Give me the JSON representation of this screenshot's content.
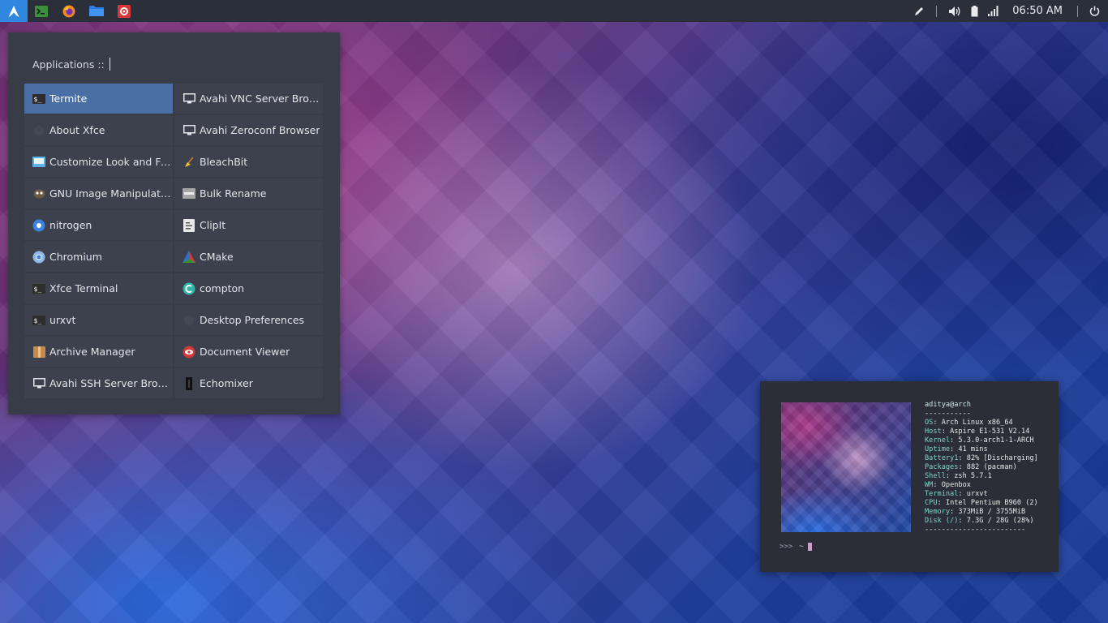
{
  "panel": {
    "launchers": [
      "terminal-icon",
      "firefox-icon",
      "files-icon",
      "settings-icon"
    ],
    "clock": "06:50 AM",
    "tray_icons": [
      "pen-icon",
      "volume-icon",
      "battery-icon",
      "signal-icon",
      "power-icon"
    ]
  },
  "menu": {
    "search_label": "Applications ::",
    "search_value": "",
    "items": [
      {
        "label": "Termite",
        "icon": "terminal-icon"
      },
      {
        "label": "Avahi VNC Server Brow...",
        "icon": "monitor-icon"
      },
      {
        "label": "About Xfce",
        "icon": "xfce-icon"
      },
      {
        "label": "Avahi Zeroconf Browser",
        "icon": "monitor-icon"
      },
      {
        "label": "Customize Look and Feel",
        "icon": "appearance-icon"
      },
      {
        "label": "BleachBit",
        "icon": "broom-icon"
      },
      {
        "label": "GNU Image Manipulati...",
        "icon": "gimp-icon"
      },
      {
        "label": "Bulk Rename",
        "icon": "rename-icon"
      },
      {
        "label": "nitrogen",
        "icon": "nitrogen-icon"
      },
      {
        "label": "ClipIt",
        "icon": "clipboard-icon"
      },
      {
        "label": "Chromium",
        "icon": "chromium-icon"
      },
      {
        "label": "CMake",
        "icon": "cmake-icon"
      },
      {
        "label": "Xfce Terminal",
        "icon": "terminal-icon"
      },
      {
        "label": "compton",
        "icon": "compton-icon"
      },
      {
        "label": "urxvt",
        "icon": "terminal-icon"
      },
      {
        "label": "Desktop Preferences",
        "icon": "desktop-icon"
      },
      {
        "label": "Archive Manager",
        "icon": "archive-icon"
      },
      {
        "label": "Document Viewer",
        "icon": "eye-icon"
      },
      {
        "label": "Avahi SSH Server Brow...",
        "icon": "monitor-icon"
      },
      {
        "label": "Echomixer",
        "icon": "mixer-icon"
      }
    ]
  },
  "terminal": {
    "header": "aditya@arch",
    "separator": "-----------",
    "info": [
      {
        "key": "OS",
        "value": "Arch Linux x86_64"
      },
      {
        "key": "Host",
        "value": "Aspire E1-531 V2.14"
      },
      {
        "key": "Kernel",
        "value": "5.3.0-arch1-1-ARCH"
      },
      {
        "key": "Uptime",
        "value": "41 mins"
      },
      {
        "key": "Battery1",
        "value": "82% [Discharging]"
      },
      {
        "key": "Packages",
        "value": "882 (pacman)"
      },
      {
        "key": "Shell",
        "value": "zsh 5.7.1"
      },
      {
        "key": "WM",
        "value": "Openbox"
      },
      {
        "key": "Terminal",
        "value": "urxvt"
      },
      {
        "key": "CPU",
        "value": "Intel Pentium B960 (2)"
      },
      {
        "key": "Memory",
        "value": "373MiB / 3755MiB"
      },
      {
        "key": "Disk (/)",
        "value": "7.3G / 28G (28%)"
      }
    ],
    "footer": "------------------------",
    "prompt": ">>>",
    "cwd": "~"
  },
  "colors": {
    "panel": "#2b2f39",
    "menu_button": "#2f87e0",
    "menu_bg": "#373c47",
    "selected_item": "#4a6fa5",
    "terminal_bg": "#2b2e37",
    "info_key": "#7fd4c8"
  }
}
